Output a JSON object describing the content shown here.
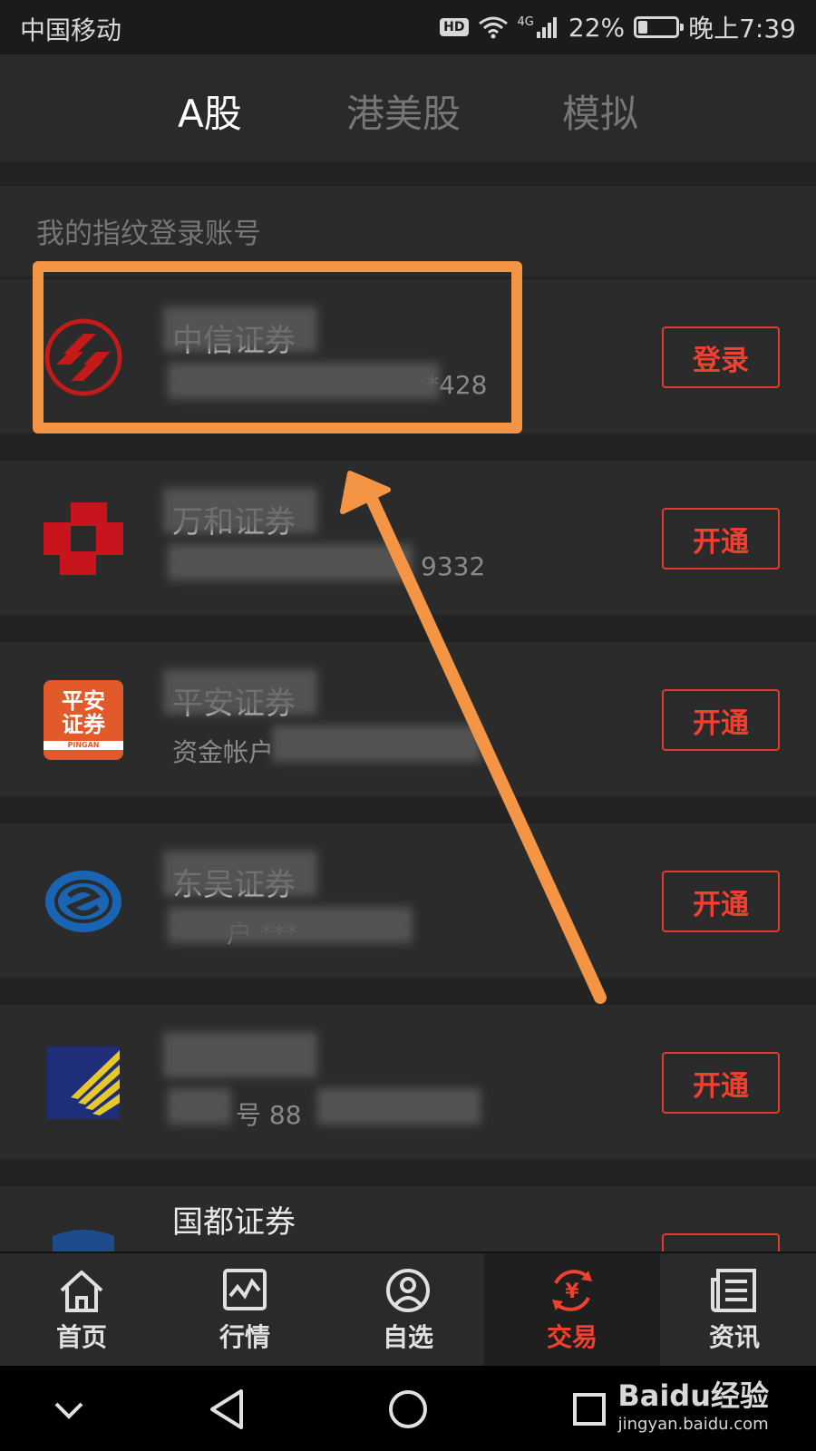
{
  "status_bar": {
    "carrier": "中国移动",
    "hd": "HD",
    "network": "4G",
    "battery_percent": "22%",
    "battery_level": 0.22,
    "time": "晚上7:39"
  },
  "top_tabs": [
    {
      "label": "A股",
      "active": true
    },
    {
      "label": "港美股",
      "active": false
    },
    {
      "label": "模拟",
      "active": false
    }
  ],
  "section": {
    "title": "我的指纹登录账号"
  },
  "rows": [
    {
      "name": "中信证券",
      "account": "*428",
      "button": "登录",
      "logo": "citic-logo"
    },
    {
      "name": "万和证券",
      "account": "9332",
      "button": "开通",
      "logo": "wanhe-logo"
    },
    {
      "name": "平安证券",
      "account": "资金帐户",
      "button": "开通",
      "logo": "pingan-logo",
      "logo_text": [
        "平安",
        "证券",
        "PINGAN"
      ]
    },
    {
      "name": "东吴证券",
      "account": "户 ***",
      "button": "开通",
      "logo": "dongwu-logo"
    },
    {
      "name": "",
      "account": "号 88",
      "button": "开通",
      "logo": "yellow-stripes-logo"
    },
    {
      "name": "国都证券",
      "account": "",
      "button": "",
      "logo": "guodu-logo"
    }
  ],
  "bottom_nav": [
    {
      "label": "首页",
      "icon": "home-icon",
      "active": false
    },
    {
      "label": "行情",
      "icon": "market-chart-icon",
      "active": false
    },
    {
      "label": "自选",
      "icon": "watchlist-user-icon",
      "active": false
    },
    {
      "label": "交易",
      "icon": "trade-yen-icon",
      "active": true
    },
    {
      "label": "资讯",
      "icon": "news-icon",
      "active": false
    }
  ],
  "system_nav": {
    "watermark_main": "Baidu经验",
    "watermark_sub": "jingyan.baidu.com"
  },
  "colors": {
    "accent": "#ef4030",
    "annotation": "#f39545",
    "background": "#232323"
  }
}
